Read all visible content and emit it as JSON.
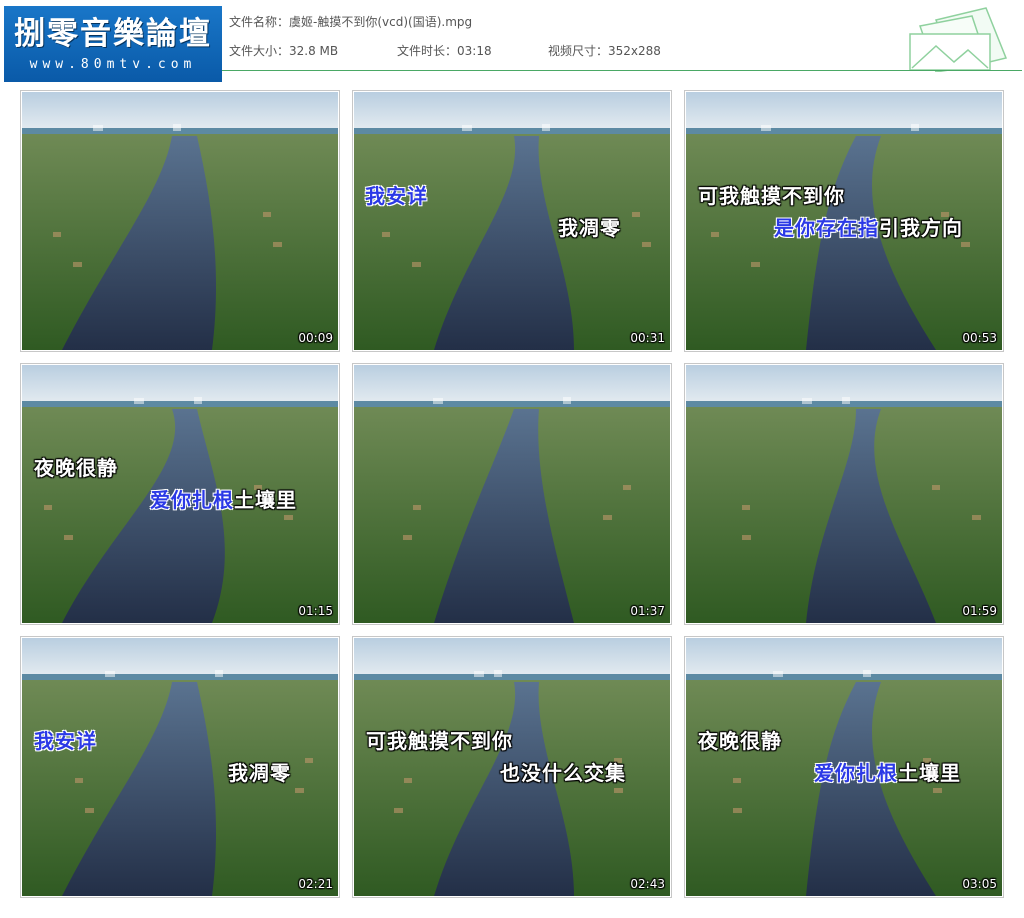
{
  "logo": {
    "title": "捌零音樂論壇",
    "url": "www.80mtv.com"
  },
  "file": {
    "name_label": "文件名称：",
    "name": "虞姬-触摸不到你(vcd)(国语).mpg",
    "size_label": "文件大小：",
    "size": "32.8 MB",
    "duration_label": "文件时长：",
    "duration": "03:18",
    "dims_label": "视频尺寸：",
    "dims": "352x288"
  },
  "colors": {
    "accent_line": "#4aa865",
    "logo_bg": "#1976c8",
    "subtitle_blue": "#2b39e6"
  },
  "thumbnails": [
    {
      "time": "00:09",
      "sub1": "",
      "sub2a": "",
      "sub2b": ""
    },
    {
      "time": "00:31",
      "sub1": "我安详",
      "sub2a": "我凋零",
      "sub2b": ""
    },
    {
      "time": "00:53",
      "sub1": "可我触摸不到你",
      "sub2a": "是你存在指",
      "sub2b": "引我方向"
    },
    {
      "time": "01:15",
      "sub1": "夜晚很静",
      "sub2a": "爱你扎根",
      "sub2b": "土壤里"
    },
    {
      "time": "01:37",
      "sub1": "",
      "sub2a": "",
      "sub2b": ""
    },
    {
      "time": "01:59",
      "sub1": "",
      "sub2a": "",
      "sub2b": ""
    },
    {
      "time": "02:21",
      "sub1": "我安详",
      "sub2a": "我凋零",
      "sub2b": ""
    },
    {
      "time": "02:43",
      "sub1": "可我触摸不到你",
      "sub2a": "也没什么交集",
      "sub2b": ""
    },
    {
      "time": "03:05",
      "sub1": "夜晚很静",
      "sub2a": "爱你扎根",
      "sub2b": "土壤里"
    }
  ]
}
